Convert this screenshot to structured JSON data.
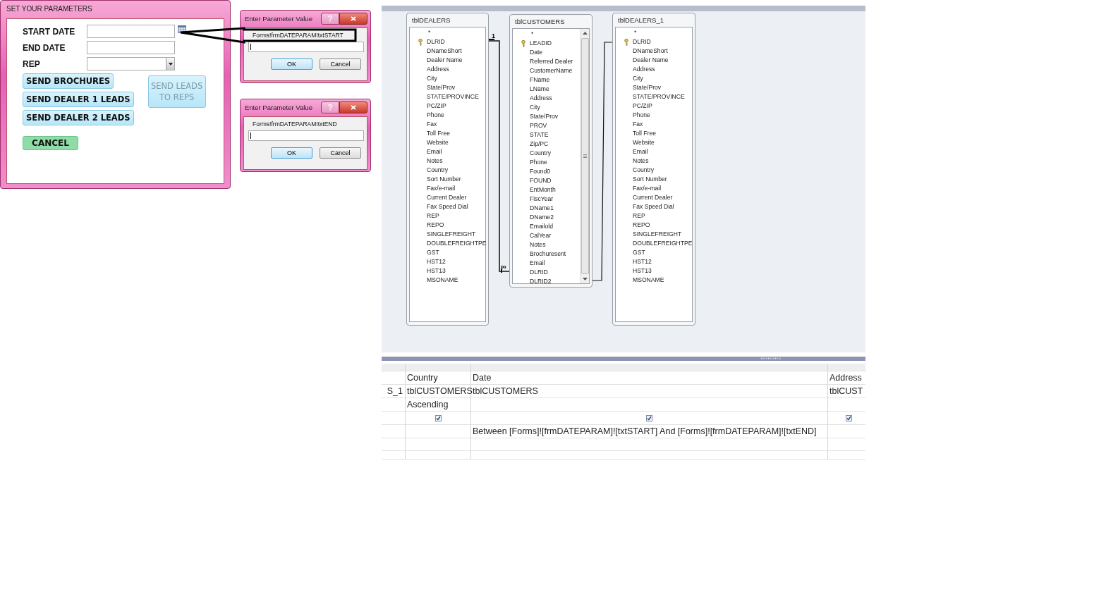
{
  "form": {
    "title": "SET YOUR PARAMETERS",
    "fields": [
      {
        "label": "START DATE",
        "kind": "date"
      },
      {
        "label": "END DATE",
        "kind": "text"
      },
      {
        "label": "REP",
        "kind": "combo"
      }
    ],
    "buttons": [
      {
        "label": "SEND BROCHURES",
        "disabled": false
      },
      {
        "label": "SEND DEALER 1 LEADS",
        "disabled": false
      },
      {
        "label": "SEND DEALER 2 LEADS",
        "disabled": false
      }
    ],
    "side_button": {
      "label": "SEND LEADS TO REPS",
      "disabled": true
    },
    "cancel": {
      "label": "CANCEL"
    }
  },
  "dialogs": [
    {
      "title": "Enter Parameter Value",
      "prompt": "Forms!frmDATEPARAM!txtSTART",
      "buttons": [
        {
          "label": "OK",
          "default": true
        },
        {
          "label": "Cancel",
          "default": false
        }
      ]
    },
    {
      "title": "Enter Parameter Value",
      "prompt": "Forms!frmDATEPARAM!txtEND",
      "buttons": [
        {
          "label": "OK",
          "default": true
        },
        {
          "label": "Cancel",
          "default": false
        }
      ]
    }
  ],
  "tables": [
    {
      "name": "tblDEALERS",
      "fields": [
        {
          "name": "*",
          "key": false
        },
        {
          "name": "DLRID",
          "key": true
        },
        {
          "name": "DNameShort",
          "key": false
        },
        {
          "name": "Dealer Name",
          "key": false
        },
        {
          "name": "Address",
          "key": false
        },
        {
          "name": "City",
          "key": false
        },
        {
          "name": "State/Prov",
          "key": false
        },
        {
          "name": "STATE/PROVINCE",
          "key": false
        },
        {
          "name": "PC/ZIP",
          "key": false
        },
        {
          "name": "Phone",
          "key": false
        },
        {
          "name": "Fax",
          "key": false
        },
        {
          "name": "Toll Free",
          "key": false
        },
        {
          "name": "Website",
          "key": false
        },
        {
          "name": "Email",
          "key": false
        },
        {
          "name": "Notes",
          "key": false
        },
        {
          "name": "Country",
          "key": false
        },
        {
          "name": "Sort Number",
          "key": false
        },
        {
          "name": "Fax/e-mail",
          "key": false
        },
        {
          "name": "Current Dealer",
          "key": false
        },
        {
          "name": "Fax Speed Dial",
          "key": false
        },
        {
          "name": "REP",
          "key": false
        },
        {
          "name": "REPO",
          "key": false
        },
        {
          "name": "SINGLEFREIGHT",
          "key": false
        },
        {
          "name": "DOUBLEFREIGHTPE",
          "key": false
        },
        {
          "name": "GST",
          "key": false
        },
        {
          "name": "HST12",
          "key": false
        },
        {
          "name": "HST13",
          "key": false
        },
        {
          "name": "MSONAME",
          "key": false
        }
      ]
    },
    {
      "name": "tblCUSTOMERS",
      "scrollbar": true,
      "fields": [
        {
          "name": "*",
          "key": false
        },
        {
          "name": "LEADID",
          "key": true
        },
        {
          "name": "Date",
          "key": false
        },
        {
          "name": "Referred Dealer",
          "key": false
        },
        {
          "name": "CustomerName",
          "key": false
        },
        {
          "name": "FName",
          "key": false
        },
        {
          "name": "LName",
          "key": false
        },
        {
          "name": "Address",
          "key": false
        },
        {
          "name": "City",
          "key": false
        },
        {
          "name": "State/Prov",
          "key": false
        },
        {
          "name": "PROV",
          "key": false
        },
        {
          "name": "STATE",
          "key": false
        },
        {
          "name": "Zip/PC",
          "key": false
        },
        {
          "name": "Country",
          "key": false
        },
        {
          "name": "Phone",
          "key": false
        },
        {
          "name": "Found0",
          "key": false
        },
        {
          "name": "FOUND",
          "key": false
        },
        {
          "name": "EntMonth",
          "key": false
        },
        {
          "name": "FiscYear",
          "key": false
        },
        {
          "name": "DName1",
          "key": false
        },
        {
          "name": "DName2",
          "key": false
        },
        {
          "name": "Emailold",
          "key": false
        },
        {
          "name": "CalYear",
          "key": false
        },
        {
          "name": "Notes",
          "key": false
        },
        {
          "name": "Brochuresent",
          "key": false
        },
        {
          "name": "Email",
          "key": false
        },
        {
          "name": "DLRID",
          "key": false
        },
        {
          "name": "DLRID2",
          "key": false
        }
      ]
    },
    {
      "name": "tblDEALERS_1",
      "fields": [
        {
          "name": "*",
          "key": false
        },
        {
          "name": "DLRID",
          "key": true
        },
        {
          "name": "DNameShort",
          "key": false
        },
        {
          "name": "Dealer Name",
          "key": false
        },
        {
          "name": "Address",
          "key": false
        },
        {
          "name": "City",
          "key": false
        },
        {
          "name": "State/Prov",
          "key": false
        },
        {
          "name": "STATE/PROVINCE",
          "key": false
        },
        {
          "name": "PC/ZIP",
          "key": false
        },
        {
          "name": "Phone",
          "key": false
        },
        {
          "name": "Fax",
          "key": false
        },
        {
          "name": "Toll Free",
          "key": false
        },
        {
          "name": "Website",
          "key": false
        },
        {
          "name": "Email",
          "key": false
        },
        {
          "name": "Notes",
          "key": false
        },
        {
          "name": "Country",
          "key": false
        },
        {
          "name": "Sort Number",
          "key": false
        },
        {
          "name": "Fax/e-mail",
          "key": false
        },
        {
          "name": "Current Dealer",
          "key": false
        },
        {
          "name": "Fax Speed Dial",
          "key": false
        },
        {
          "name": "REP",
          "key": false
        },
        {
          "name": "REPO",
          "key": false
        },
        {
          "name": "SINGLEFREIGHT",
          "key": false
        },
        {
          "name": "DOUBLEFREIGHTPE",
          "key": false
        },
        {
          "name": "GST",
          "key": false
        },
        {
          "name": "HST12",
          "key": false
        },
        {
          "name": "HST13",
          "key": false
        },
        {
          "name": "MSONAME",
          "key": false
        }
      ]
    }
  ],
  "relationships": [
    {
      "one_label": "1",
      "many_label": "∞"
    }
  ],
  "grid": {
    "columns": [
      {
        "table": "S_1"
      },
      {
        "field": "Country",
        "table": "tblCUSTOMERS",
        "sort": "Ascending",
        "show": true
      },
      {
        "field": "Date",
        "table": "tblCUSTOMERS",
        "show": true,
        "criteria": "Between [Forms]![frmDATEPARAM]![txtSTART] And [Forms]![frmDATEPARAM]![txtEND]"
      },
      {
        "field": "Address",
        "table": "tblCUST",
        "show": true
      }
    ]
  }
}
